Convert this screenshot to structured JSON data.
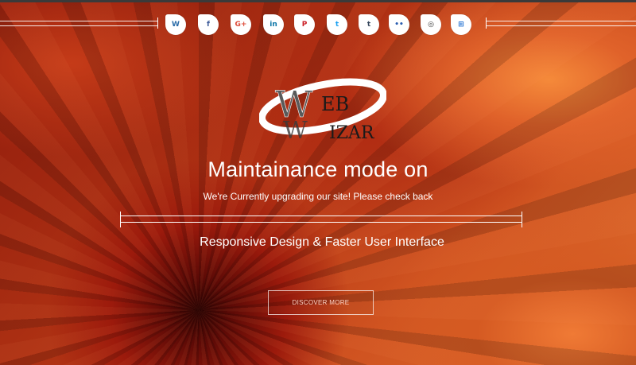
{
  "social_icons": [
    {
      "name": "wordpress-icon",
      "glyph": "W",
      "color": "#2a6ca8"
    },
    {
      "name": "facebook-icon",
      "glyph": "f",
      "color": "#3b5998"
    },
    {
      "name": "google-plus-icon",
      "glyph": "G+",
      "color": "#dd4b39"
    },
    {
      "name": "linkedin-icon",
      "glyph": "in",
      "color": "#0e76a8"
    },
    {
      "name": "pinterest-icon",
      "glyph": "P",
      "color": "#cb2027"
    },
    {
      "name": "twitter-icon",
      "glyph": "t",
      "color": "#1da1f2"
    },
    {
      "name": "tumblr-icon",
      "glyph": "t",
      "color": "#35465c"
    },
    {
      "name": "flickr-icon",
      "glyph": "••",
      "color": "#2a5db0"
    },
    {
      "name": "instagram-icon",
      "glyph": "◎",
      "color": "#3a3a3a"
    },
    {
      "name": "windows-icon",
      "glyph": "⊞",
      "color": "#1f6fd1"
    }
  ],
  "logo": {
    "line1": "EB",
    "line2": "IZAR",
    "letter_w": "W",
    "letter_w2": "W"
  },
  "hero": {
    "title": "Maintainance mode on",
    "subtitle": "We're Currently upgrading our site! Please check back",
    "tagline": "Responsive Design & Faster User Interface"
  },
  "cta": {
    "label": "DISCOVER MORE"
  },
  "colors": {
    "accent": "#ffffff",
    "brand_dark": "#1a1a1a"
  }
}
